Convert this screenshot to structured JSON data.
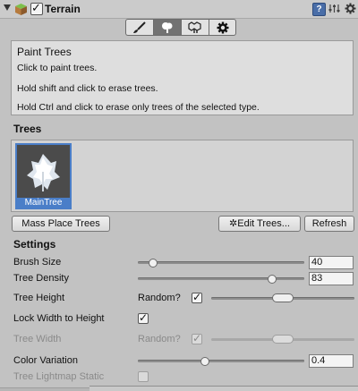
{
  "header": {
    "title": "Terrain",
    "enabled": true,
    "help_label": "?"
  },
  "toolbar": {
    "tools": [
      "paintbrush-icon",
      "tree-brush-icon",
      "detail-brush-icon",
      "gear-icon"
    ],
    "active_index": 1
  },
  "help": {
    "title": "Paint Trees",
    "lines": [
      "Click to paint trees.",
      "Hold shift and click to erase trees.",
      "Hold Ctrl and click to erase only trees of the selected type."
    ]
  },
  "trees": {
    "section_label": "Trees",
    "items": [
      {
        "label": "MainTree",
        "selected": true
      }
    ]
  },
  "buttons": {
    "mass_place": "Mass Place Trees",
    "edit_trees": "Edit Trees...",
    "refresh": "Refresh"
  },
  "settings": {
    "section_label": "Settings",
    "brush_size": {
      "label": "Brush Size",
      "value": "40",
      "fraction": 0.09
    },
    "tree_density": {
      "label": "Tree Density",
      "value": "83",
      "fraction": 0.82
    },
    "tree_height": {
      "label": "Tree Height",
      "random_label": "Random?",
      "random": true
    },
    "lock_width": {
      "label": "Lock Width to Height",
      "checked": true
    },
    "tree_width": {
      "label": "Tree Width",
      "random_label": "Random?",
      "random": true,
      "disabled": true
    },
    "color_variation": {
      "label": "Color Variation",
      "value": "0.4",
      "fraction": 0.4
    },
    "lightmap_static": {
      "label": "Tree Lightmap Static",
      "checked": false,
      "disabled": true
    }
  },
  "colors": {
    "panel_bg": "#c2c2c2",
    "selection_blue": "#4a7ec8",
    "active_tool": "#727272"
  }
}
